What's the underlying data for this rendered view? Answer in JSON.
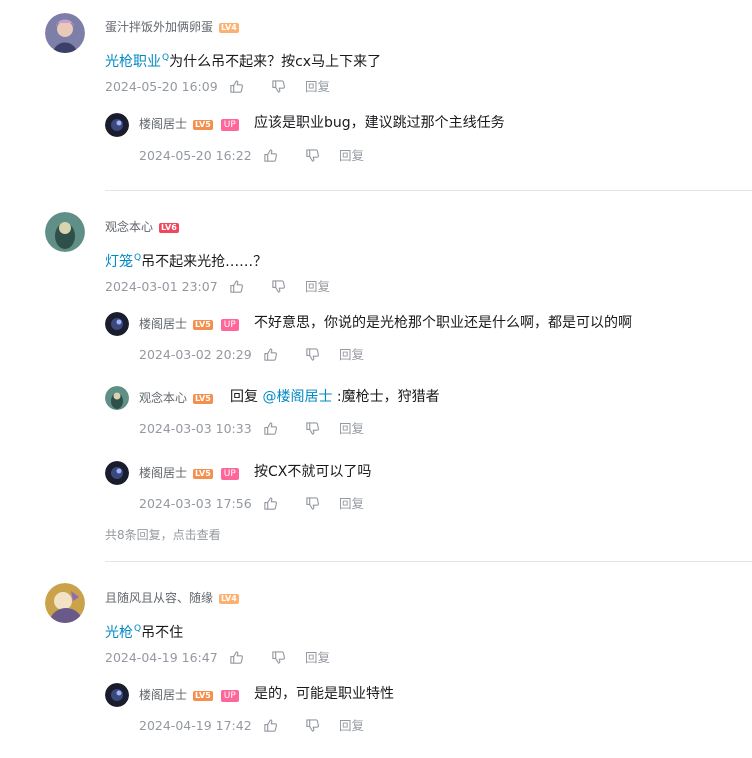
{
  "colors": {
    "link": "#008ac5",
    "meta": "#9499a0",
    "lv4": "#fdb06f",
    "lv5": "#f58f4d",
    "lv6": "#f2465d",
    "up": "#ff6699"
  },
  "threads": [
    {
      "user": {
        "name": "蛋汁拌饭外加俩卵蛋",
        "level": "LV4"
      },
      "content": {
        "link": "光枪职业",
        "text": "为什么吊不起来？按cx马上下来了"
      },
      "time": "2024-05-20 16:09",
      "reply_label": "回复",
      "replies": [
        {
          "user": {
            "name": "楼阁居士",
            "level": "LV5",
            "badge": "UP"
          },
          "text": "应该是职业bug，建议跳过那个主线任务",
          "time": "2024-05-20 16:22",
          "reply_label": "回复"
        }
      ]
    },
    {
      "user": {
        "name": "观念本心",
        "level": "LV6"
      },
      "content": {
        "link": "灯笼",
        "text": "吊不起来光抢……？"
      },
      "time": "2024-03-01 23:07",
      "reply_label": "回复",
      "replies": [
        {
          "user": {
            "name": "楼阁居士",
            "level": "LV5",
            "badge": "UP"
          },
          "text": "不好意思，你说的是光枪那个职业还是什么啊，都是可以的啊",
          "time": "2024-03-02 20:29",
          "reply_label": "回复"
        },
        {
          "user": {
            "name": "观念本心",
            "level": "LV5"
          },
          "prefix": "回复",
          "mention": "@楼阁居士",
          "text": ":魔枪士，狩猎者",
          "time": "2024-03-03 10:33",
          "reply_label": "回复"
        },
        {
          "user": {
            "name": "楼阁居士",
            "level": "LV5",
            "badge": "UP"
          },
          "text": "按CX不就可以了吗",
          "time": "2024-03-03 17:56",
          "reply_label": "回复"
        }
      ],
      "more": {
        "count_text": "共8条回复，",
        "action": "点击查看"
      }
    },
    {
      "user": {
        "name": "且随风且从容、随缘",
        "level": "LV4"
      },
      "content": {
        "link": "光枪",
        "text": "吊不住"
      },
      "time": "2024-04-19 16:47",
      "reply_label": "回复",
      "replies": [
        {
          "user": {
            "name": "楼阁居士",
            "level": "LV5",
            "badge": "UP"
          },
          "text": "是的，可能是职业特性",
          "time": "2024-04-19 17:42",
          "reply_label": "回复"
        }
      ]
    }
  ],
  "search_mark": "Q",
  "icons": {
    "like": "thumb-up-icon",
    "dislike": "thumb-down-icon"
  }
}
